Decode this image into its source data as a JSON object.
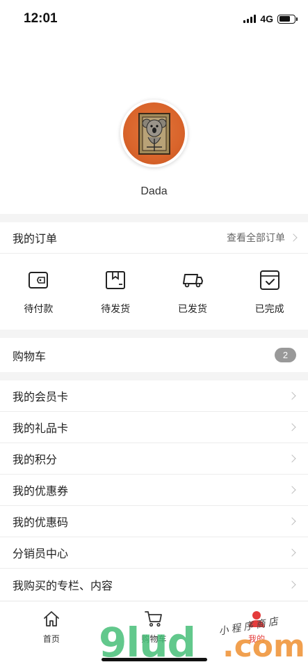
{
  "status_bar": {
    "time": "12:01",
    "network": "4G"
  },
  "capsule": {
    "more_icon": "more-dots-icon",
    "close_icon": "target-close-icon"
  },
  "profile": {
    "username": "Dada"
  },
  "orders": {
    "title": "我的订单",
    "view_all": "查看全部订单",
    "items": [
      {
        "label": "待付款",
        "icon": "wallet-icon"
      },
      {
        "label": "待发货",
        "icon": "package-icon"
      },
      {
        "label": "已发货",
        "icon": "truck-icon"
      },
      {
        "label": "已完成",
        "icon": "check-box-icon"
      }
    ]
  },
  "cart": {
    "label": "购物车",
    "count": "2"
  },
  "menu": [
    {
      "label": "我的会员卡"
    },
    {
      "label": "我的礼品卡"
    },
    {
      "label": "我的积分"
    },
    {
      "label": "我的优惠券"
    },
    {
      "label": "我的优惠码"
    },
    {
      "label": "分销员中心"
    },
    {
      "label": "我购买的专栏、内容"
    }
  ],
  "tabbar": {
    "items": [
      {
        "label": "首页",
        "icon": "home-icon"
      },
      {
        "label": "购物车",
        "icon": "cart-icon"
      },
      {
        "label": "我的",
        "icon": "user-icon"
      }
    ],
    "active_color": "#e43b3b"
  },
  "watermark": {
    "big": "9lud",
    "dotcom": ".com",
    "small": "小程序商店"
  }
}
